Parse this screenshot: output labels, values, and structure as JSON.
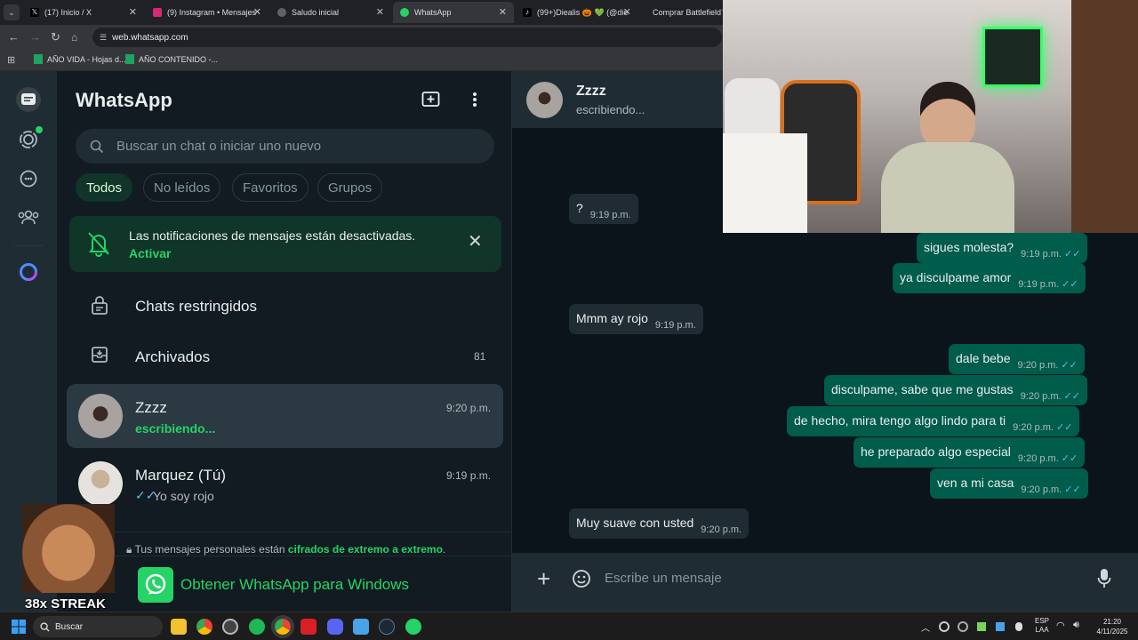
{
  "browser": {
    "tabs": [
      {
        "label": "(17) Inicio / X",
        "icon": "x-icon"
      },
      {
        "label": "(9) Instagram • Mensajes",
        "icon": "instagram-icon"
      },
      {
        "label": "Saludo inicial",
        "icon": "globe-icon"
      },
      {
        "label": "WhatsApp",
        "icon": "whatsapp-icon"
      },
      {
        "label": "(99+)Diealis 🎃 💚 (@die",
        "icon": "tiktok-icon"
      },
      {
        "label": "Comprar Battlefield™",
        "icon": "ea-icon"
      }
    ],
    "url": "web.whatsapp.com",
    "bookmarks": [
      "AÑO VIDA - Hojas d...",
      "AÑO CONTENIDO -..."
    ]
  },
  "sidebar": {
    "title": "WhatsApp",
    "search_placeholder": "Buscar un chat o iniciar uno nuevo",
    "filters": [
      "Todos",
      "No leídos",
      "Favoritos",
      "Grupos"
    ],
    "notice_text": "Las notificaciones de mensajes están desactivadas.",
    "notice_action": "Activar",
    "restricted": "Chats restringidos",
    "archived": "Archivados",
    "archived_count": "81",
    "chats": [
      {
        "name": "Zzzz",
        "time": "9:20 p.m.",
        "preview": "escribiendo..."
      },
      {
        "name": "Marquez (Tú)",
        "time": "9:19 p.m.",
        "preview": "Yo soy rojo"
      }
    ],
    "encryption_prefix": "Tus mensajes personales están",
    "encryption_link": "cifrados de extremo a extremo",
    "encryption_suffix": ".",
    "get_app": "Obtener WhatsApp para Windows"
  },
  "chat": {
    "contact_name": "Zzzz",
    "contact_status": "escribiendo...",
    "messages": [
      {
        "dir": "in",
        "text": "?",
        "time": "9:19 p.m."
      },
      {
        "dir": "out",
        "text": "sigues molesta?",
        "time": "9:19 p.m."
      },
      {
        "dir": "out",
        "text": "ya disculpame amor",
        "time": "9:19 p.m."
      },
      {
        "dir": "in",
        "text": "Mmm ay rojo",
        "time": "9:19 p.m."
      },
      {
        "dir": "out",
        "text": "dale bebe",
        "time": "9:20 p.m."
      },
      {
        "dir": "out",
        "text": "disculpame, sabe que me gustas",
        "time": "9:20 p.m."
      },
      {
        "dir": "out",
        "text": "de hecho, mira tengo algo lindo para ti",
        "time": "9:20 p.m."
      },
      {
        "dir": "out",
        "text": "he preparado algo especial",
        "time": "9:20 p.m."
      },
      {
        "dir": "out",
        "text": "ven a mi casa",
        "time": "9:20 p.m."
      },
      {
        "dir": "in",
        "text": "Muy suave con usted",
        "time": "9:20 p.m."
      }
    ],
    "composer_placeholder": "Escribe un mensaje"
  },
  "overlay": {
    "streak": "38x STREAK"
  },
  "taskbar": {
    "search": "Buscar",
    "lang_top": "ESP",
    "lang_bottom": "LAA",
    "time": "21:20",
    "date": "4/11/2025"
  },
  "colors": {
    "accent": "#00a884",
    "outgoing_bubble": "#005c4b",
    "incoming_bubble": "#202c33",
    "notice_bg": "#103529",
    "read_ticks": "#53bdeb"
  }
}
